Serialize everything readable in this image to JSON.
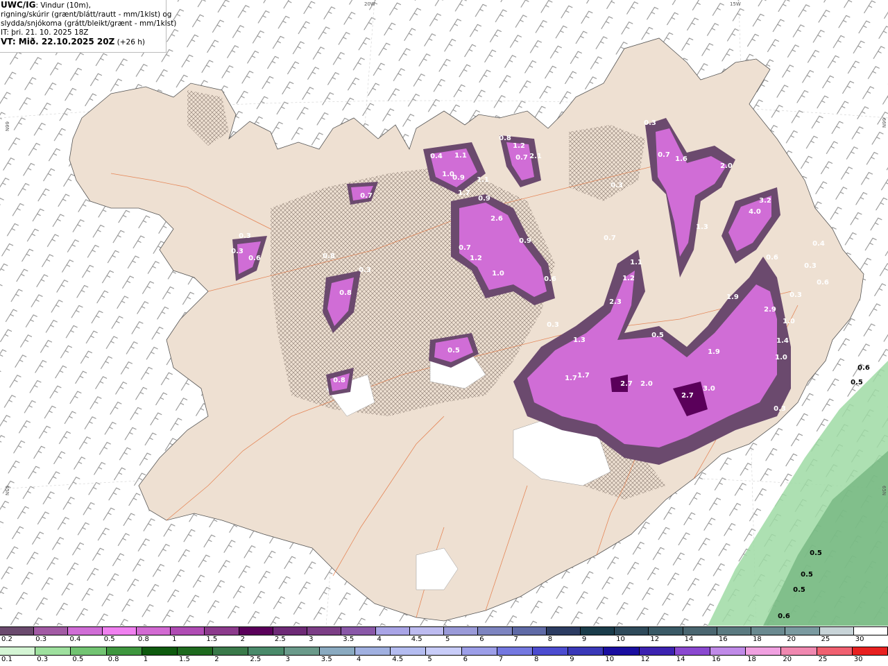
{
  "header": {
    "line1_prefix": "UWC/IG",
    "line1_suffix": ": Vindur (10m),",
    "line2": "rigning/skúrir (grænt/blátt/rautt - mm/1klst) og",
    "line3": "slydda/snjókoma (grátt/bleikt/grænt - mm/1klst)",
    "line4": "IT: þri. 21. 10. 2025 18Z",
    "line5_prefix": "VT: Mið. 22.10.2025 20Z",
    "line5_suffix": " (+26 h)"
  },
  "graticule": {
    "top_20w": "20W",
    "top_15w": "15W",
    "left_66n": "66N",
    "left_65n": "65N",
    "right_66n": "66N",
    "right_65n": "65N"
  },
  "map_labels": {
    "snow": [
      "0.3",
      "0.7",
      "1.6",
      "2.0",
      "0.3",
      "3.2",
      "4.0",
      "1.3",
      "0.4",
      "0.3",
      "0.6",
      "0.6",
      "0.4",
      "1.1",
      "1.0",
      "0.9",
      "1.1",
      "1.7",
      "0.9",
      "0.8",
      "1.2",
      "2.1",
      "0.7",
      "2.6",
      "0.7",
      "1.2",
      "1.0",
      "0.9",
      "0.6",
      "0.7",
      "1.1",
      "1.2",
      "2.3",
      "1.3",
      "0.3",
      "0.5",
      "1.9",
      "2.9",
      "1.0",
      "1.4",
      "1.0",
      "1.7",
      "1.7",
      "2.7",
      "2.0",
      "2.7",
      "3.0",
      "0.3",
      "0.3",
      "0.3",
      "0.6",
      "0.8",
      "0.7",
      "0.3",
      "0.8",
      "0.5",
      "0.8",
      "0.3",
      "1.9"
    ],
    "rain": [
      "0.6",
      "0.5",
      "0.5",
      "0.5",
      "0.5",
      "0.6"
    ]
  },
  "legend": {
    "snow_scale": {
      "labels": [
        "0.2",
        "0.3",
        "0.4",
        "0.5",
        "0.8",
        "1",
        "1.5",
        "2",
        "2.5",
        "3",
        "3.5",
        "4",
        "4.5",
        "5",
        "6",
        "7",
        "8",
        "9",
        "10",
        "12",
        "14",
        "16",
        "18",
        "20",
        "25",
        "30"
      ],
      "colors": [
        "#6b4a6e",
        "#a25aa4",
        "#d06dd6",
        "#f080f0",
        "#d26ad2",
        "#b04cb4",
        "#8c3a8c",
        "#5a005a",
        "#6e2a76",
        "#7c3e86",
        "#8a58a8",
        "#a9a4e6",
        "#bdbbf0",
        "#9a9ad8",
        "#7d84c0",
        "#5f6aa6",
        "#2c3c62",
        "#1a3c4a",
        "#2e4a5a",
        "#3a5a66",
        "#4a6670",
        "#5a7a80",
        "#6a8a90",
        "#7a9aa0",
        "#c8d4d8",
        "#ffffff"
      ]
    },
    "rain_scale": {
      "labels": [
        "0.1",
        "0.3",
        "0.5",
        "0.8",
        "1",
        "1.5",
        "2",
        "2.5",
        "3",
        "3.5",
        "4",
        "4.5",
        "5",
        "6",
        "7",
        "8",
        "9",
        "10",
        "12",
        "14",
        "16",
        "18",
        "20",
        "25",
        "30"
      ],
      "colors": [
        "#d4f5d4",
        "#9ee09e",
        "#72c472",
        "#3e963e",
        "#0e5a0e",
        "#1e6a1e",
        "#3a7a4a",
        "#4a8a6a",
        "#6a9a8a",
        "#8aaac0",
        "#a0b0e0",
        "#b4bcf0",
        "#c8ccf8",
        "#9c9ee8",
        "#7478e0",
        "#4c4cd0",
        "#3a38b8",
        "#1a0ea0",
        "#3c22b0",
        "#8a48d0",
        "#c08ae8",
        "#f0a0e0",
        "#f088b0",
        "#f06070",
        "#e82020"
      ]
    }
  }
}
